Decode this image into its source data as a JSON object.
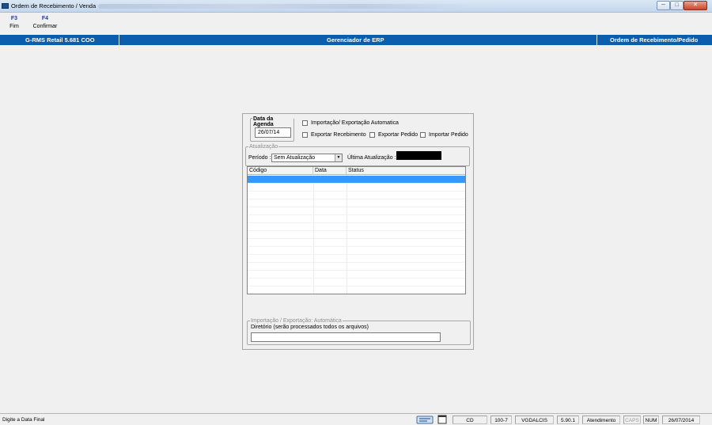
{
  "window": {
    "title": "Ordem de Recebimento / Venda",
    "controls": [
      "─",
      "□",
      "✕"
    ]
  },
  "toolbar": [
    {
      "key": "F3",
      "label": "Fim"
    },
    {
      "key": "F4",
      "label": "Confirmar"
    }
  ],
  "header": {
    "left": "G-RMS Retail 5.681 COO",
    "center": "Gerenciador de ERP",
    "right": "Ordem de Recebimento/Pedido"
  },
  "form": {
    "agenda_label": "Data da Agenda",
    "agenda_value": "26/07/14",
    "chk_auto": "Importação/ Exportação Automatica",
    "chk_export_receb": "Exportar Recebimento",
    "chk_export_pedido": "Exportar Pedido",
    "chk_import_pedido": "Importar Pedido",
    "atualizacao_label": "Atualização",
    "periodo_label": "Período :",
    "periodo_value": "Sem Atualização",
    "ultima_label": "Última Atualização :",
    "grid_columns": [
      "Código",
      "Data",
      "Status"
    ],
    "grid_selected_row": 0,
    "imp_legend": "Importação / Exportação: Automática",
    "diretorio_label": "Diretório (serão processados todos os arquivos)",
    "diretorio_value": ""
  },
  "status": {
    "message": "Digite a Data Final",
    "cd": "CD",
    "code": "100-7",
    "user": "VGDALCIS",
    "version": "5.90.1",
    "mode": "Atendimento",
    "caps": "CAPS",
    "num": "NUM",
    "date": "26/07/2014"
  },
  "colors": {
    "header_bg": "#0b5ead",
    "selection": "#3399ff",
    "black_field": "#000000"
  }
}
